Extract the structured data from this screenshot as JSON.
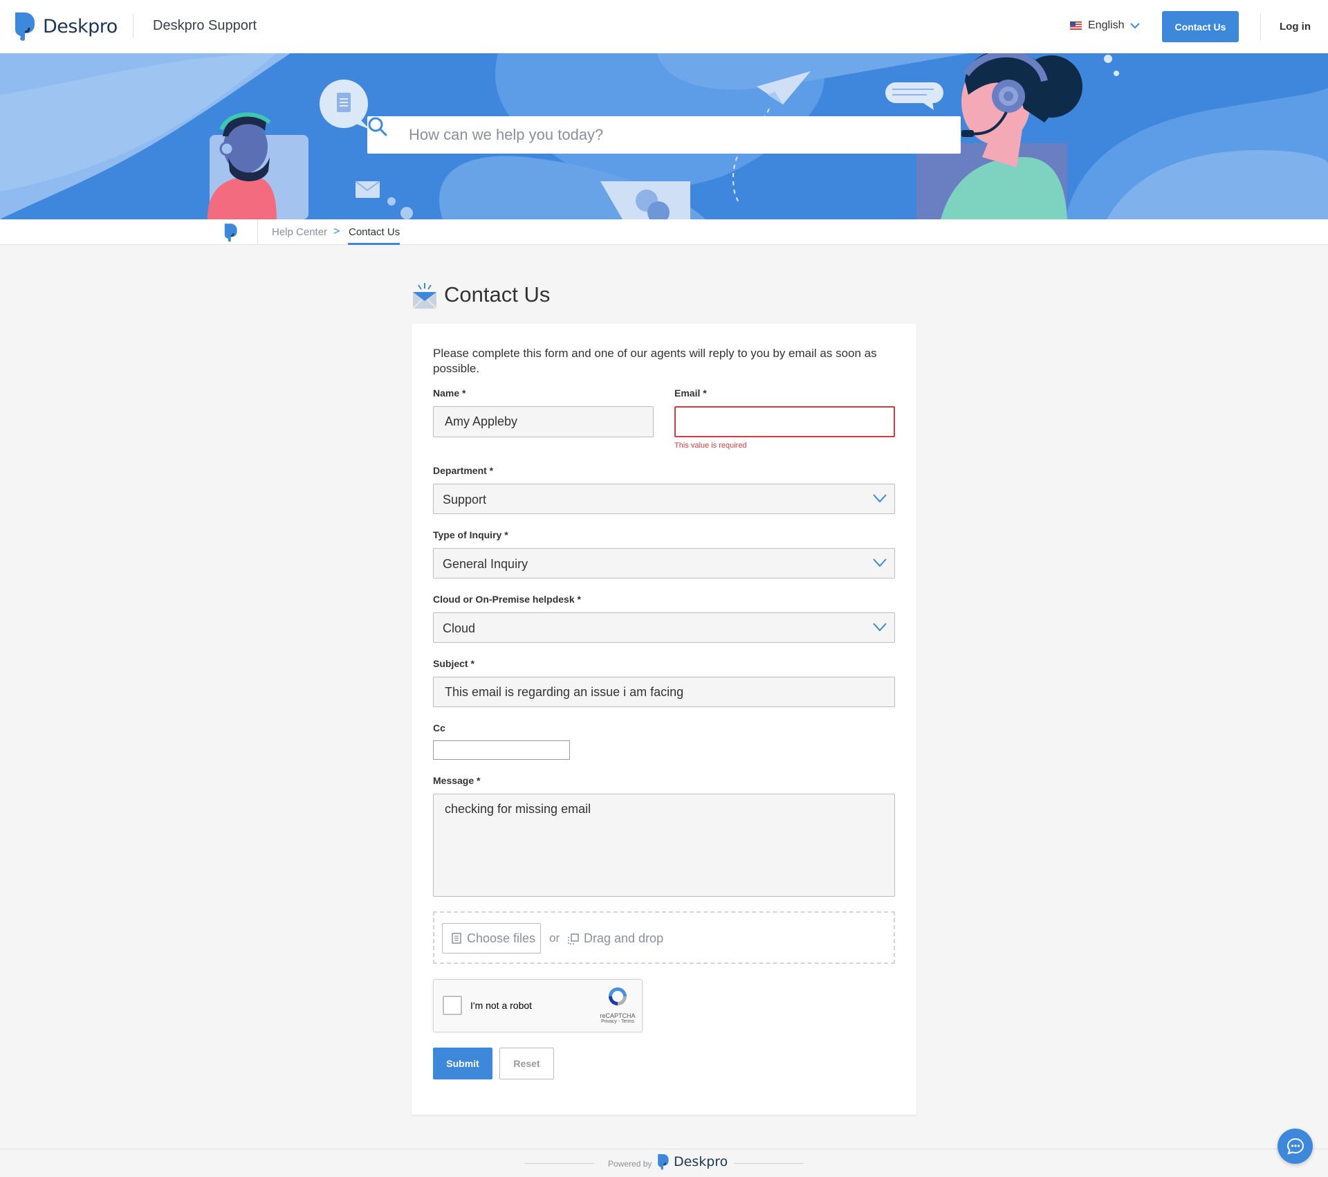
{
  "header": {
    "brand": "Deskpro",
    "site_name": "Deskpro Support",
    "language": "English",
    "contact_button": "Contact Us",
    "login": "Log in"
  },
  "search": {
    "placeholder": "How can we help you today?"
  },
  "breadcrumb": {
    "help_center": "Help Center",
    "separator": ">",
    "current": "Contact Us"
  },
  "page": {
    "title": "Contact Us"
  },
  "form": {
    "intro": "Please complete this form and one of our agents will reply to you by email as soon as possible.",
    "name_label": "Name *",
    "name_value": "Amy Appleby",
    "email_label": "Email *",
    "email_value": "",
    "email_error": "This value is required",
    "department_label": "Department *",
    "department_value": "Support",
    "inquiry_label": "Type of Inquiry *",
    "inquiry_value": "General Inquiry",
    "deploy_label": "Cloud or On-Premise helpdesk *",
    "deploy_value": "Cloud",
    "subject_label": "Subject *",
    "subject_value": "This email is regarding an issue i am facing",
    "cc_label": "Cc",
    "cc_value": "",
    "message_label": "Message *",
    "message_value": "checking for missing email",
    "choose_files": "Choose files",
    "or": "or",
    "drag_drop": "Drag and drop",
    "captcha_label": "I'm not a robot",
    "captcha_brand": "reCAPTCHA",
    "captcha_links": "Privacy - Terms",
    "submit": "Submit",
    "reset": "Reset"
  },
  "footer": {
    "powered_by": "Powered by",
    "brand": "Deskpro"
  },
  "colors": {
    "primary": "#3e88dc",
    "error": "#d13b45",
    "brand_dark": "#1d3557"
  },
  "icons": [
    "deskpro-logo-icon",
    "us-flag-icon",
    "chevron-down-icon",
    "search-icon",
    "envelope-icon",
    "file-icon",
    "drag-drop-icon",
    "recaptcha-icon",
    "chat-icon"
  ]
}
